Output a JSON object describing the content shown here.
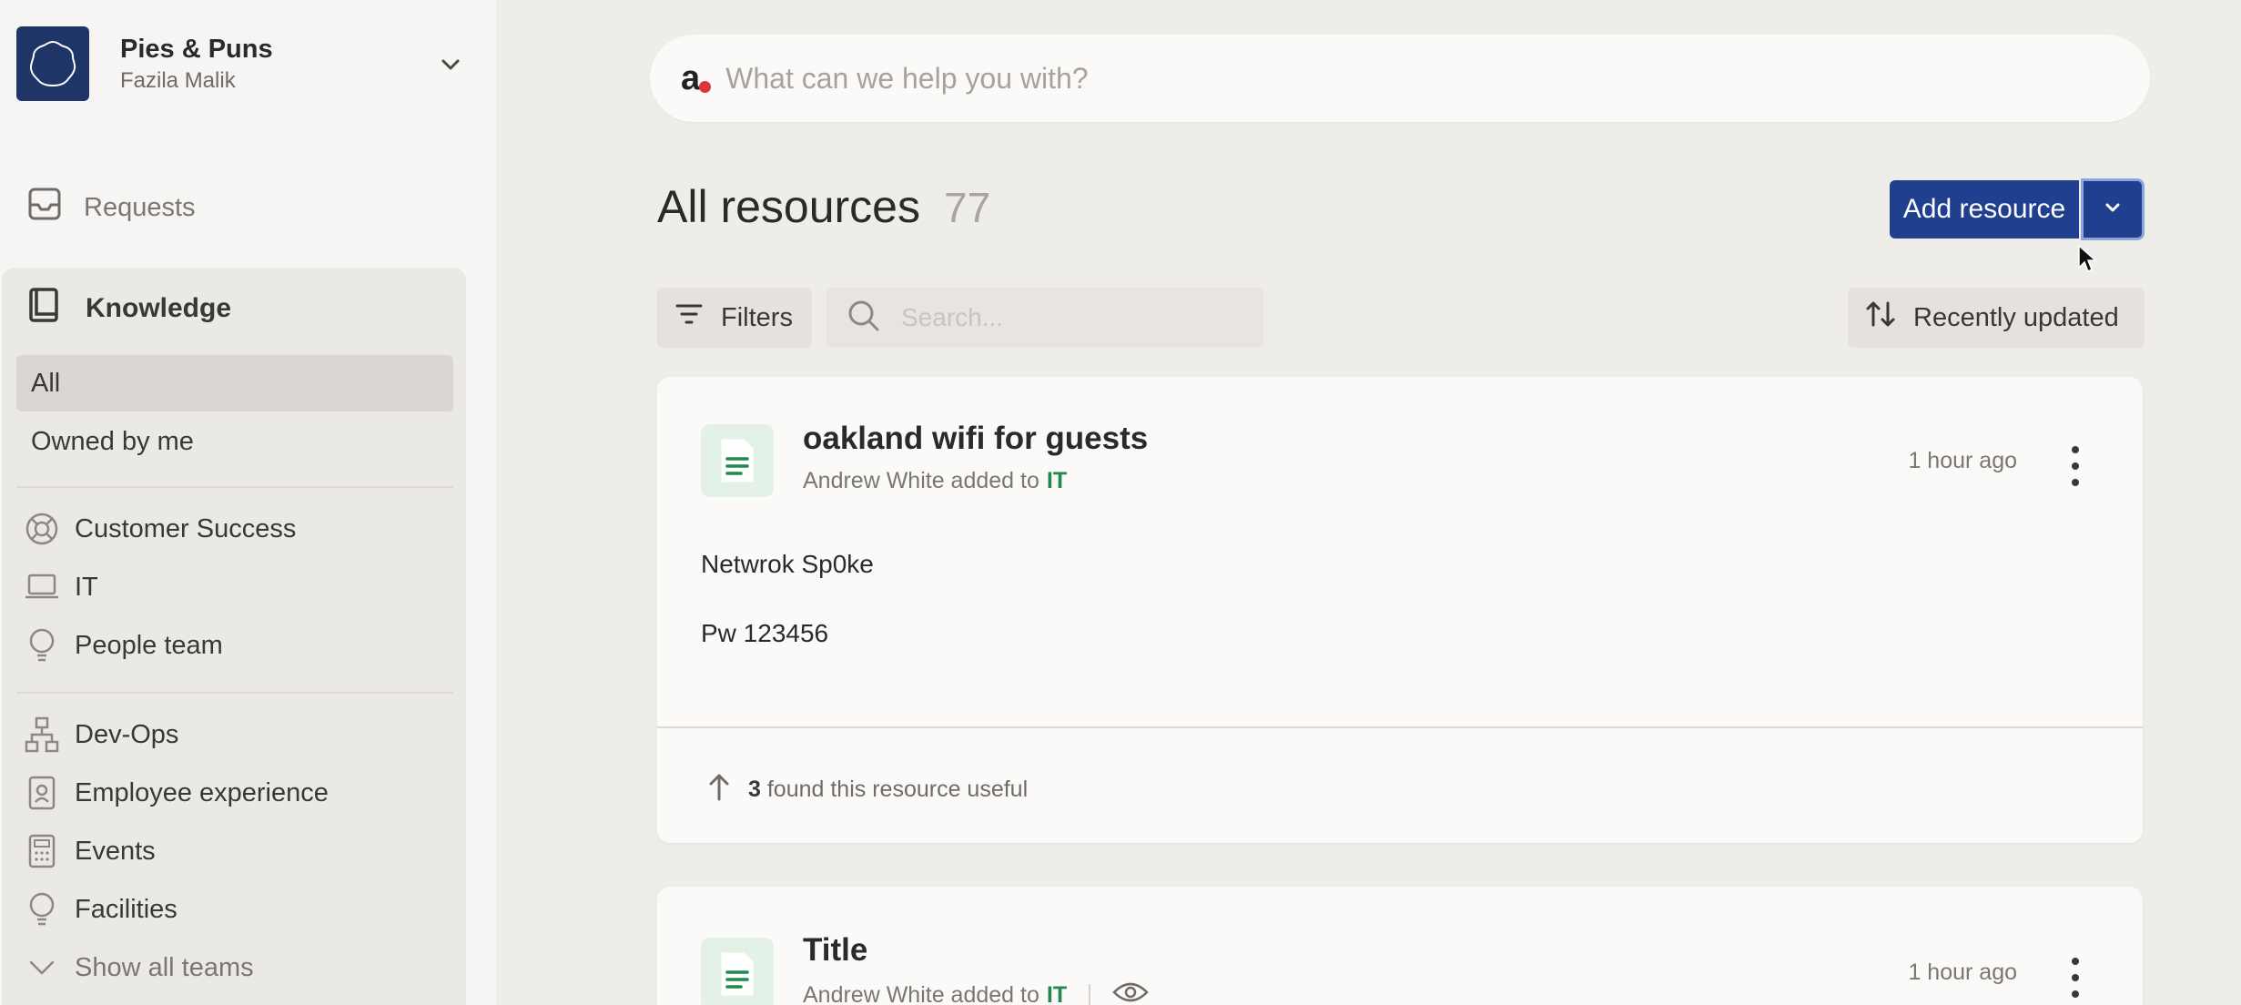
{
  "org": {
    "name": "Pies & Puns",
    "user": "Fazila Malik"
  },
  "nav": {
    "requests": "Requests",
    "knowledge": "Knowledge"
  },
  "knowledge_items": [
    "All",
    "Owned by me"
  ],
  "teams_group1": [
    "Customer Success",
    "IT",
    "People team"
  ],
  "teams_group2": [
    "Dev-Ops",
    "Employee experience",
    "Events",
    "Facilities"
  ],
  "show_all": "Show all teams",
  "search": {
    "brand": "a",
    "placeholder": "What can we help you with?"
  },
  "header": {
    "title": "All resources",
    "count": "77"
  },
  "actions": {
    "add": "Add resource",
    "filters": "Filters",
    "search_placeholder": "Search...",
    "sort": "Recently updated"
  },
  "cards": [
    {
      "title": "oakland wifi for guests",
      "author": "Andrew White added to",
      "team": "IT",
      "time": "1 hour ago",
      "body": [
        "Netwrok Sp0ke",
        "Pw 123456"
      ],
      "useful_count": "3",
      "useful_text": "found this resource useful"
    },
    {
      "title": "Title",
      "author": "Andrew White added to",
      "team": "IT",
      "time": "1 hour ago"
    }
  ],
  "colors": {
    "accent": "#213f8f",
    "team_link": "#1f8a4c",
    "org_logo": "#1f3567"
  }
}
